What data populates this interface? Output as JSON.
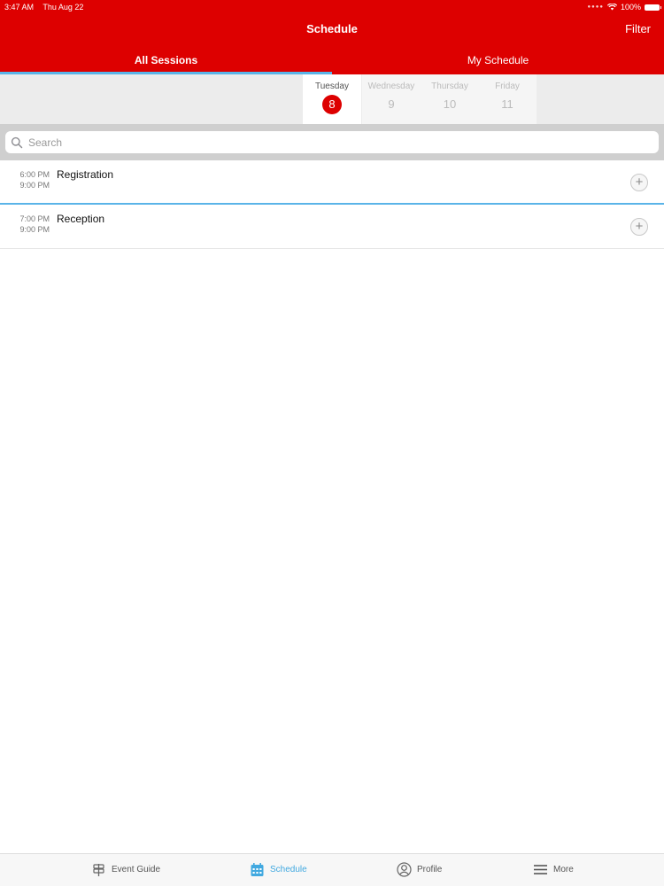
{
  "status_bar": {
    "time": "3:47 AM",
    "date": "Thu Aug 22",
    "battery": "100%"
  },
  "header": {
    "title": "Schedule",
    "filter_label": "Filter"
  },
  "tabs": [
    {
      "label": "All Sessions",
      "active": true
    },
    {
      "label": "My Schedule",
      "active": false
    }
  ],
  "days": [
    {
      "name": "Tuesday",
      "number": "8",
      "selected": true
    },
    {
      "name": "Wednesday",
      "number": "9",
      "selected": false
    },
    {
      "name": "Thursday",
      "number": "10",
      "selected": false
    },
    {
      "name": "Friday",
      "number": "11",
      "selected": false
    }
  ],
  "search": {
    "placeholder": "Search"
  },
  "sessions": [
    {
      "start": "6:00 PM",
      "end": "9:00 PM",
      "title": "Registration"
    },
    {
      "start": "7:00 PM",
      "end": "9:00 PM",
      "title": "Reception"
    }
  ],
  "tab_bar": [
    {
      "label": "Event Guide",
      "icon": "signpost-icon",
      "active": false
    },
    {
      "label": "Schedule",
      "icon": "calendar-icon",
      "active": true
    },
    {
      "label": "Profile",
      "icon": "profile-icon",
      "active": false
    },
    {
      "label": "More",
      "icon": "menu-icon",
      "active": false
    }
  ],
  "colors": {
    "brand": "#dd0000",
    "accent": "#42a9e0"
  }
}
